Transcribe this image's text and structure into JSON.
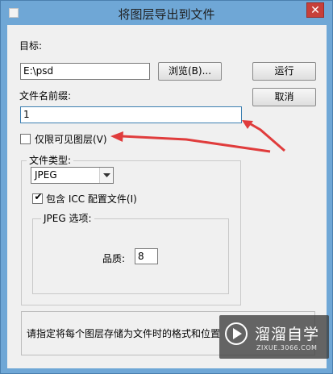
{
  "window": {
    "title": "将图层导出到文件",
    "close_label": "✕"
  },
  "target": {
    "label": "目标:",
    "path_value": "E:\\psd",
    "browse_label": "浏览(B)..."
  },
  "run_label": "运行",
  "cancel_label": "取消",
  "prefix": {
    "label": "文件名前缀:",
    "value": "1"
  },
  "visible_only": {
    "label": "仅限可见图层(V)",
    "checked": false
  },
  "file_type": {
    "group_title": "文件类型:",
    "selected": "JPEG",
    "include_icc_label": "包含 ICC 配置文件(I)",
    "include_icc_checked": true
  },
  "jpeg_options": {
    "group_title": "JPEG 选项:",
    "quality_label": "品质:",
    "quality_value": "8"
  },
  "description": {
    "text": "请指定将每个图层存储为文件时的格式和位置"
  },
  "watermark": {
    "brand": "溜溜自学",
    "url": "ZIXUE.3066.COM"
  },
  "colors": {
    "titlebar": "#6fa7d6",
    "dialog_bg": "#f0f0f0",
    "annotation_arrow": "#e03c3c",
    "close_button": "#c7403a"
  }
}
